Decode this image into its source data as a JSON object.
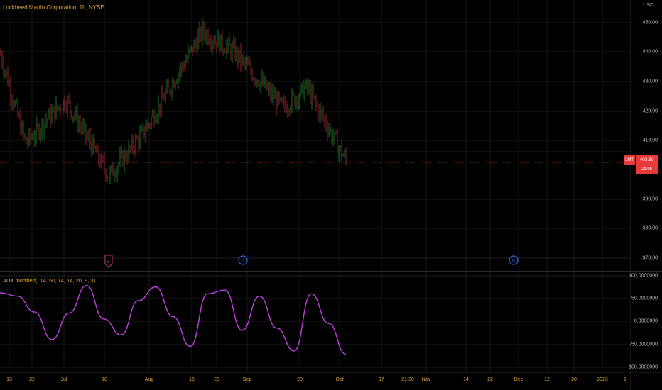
{
  "chart_title": "Lockheed Martin Corporation, 1h, NYSE",
  "currency": "USD",
  "price_axis": [
    "450.00",
    "440.00",
    "430.00",
    "420.00",
    "410.00",
    "390.00",
    "380.00",
    "370.00"
  ],
  "indicator_title": "ADX modified(, 14, 50, 14, 14, 20, 9, 3)",
  "indicator_axis": [
    "100.0000000",
    "50.0000000",
    "0.0000000",
    "-50.0000000",
    "-100.0000000"
  ],
  "time_axis": [
    "13",
    "22",
    "Jul",
    "18",
    "Aug",
    "15",
    "23",
    "Sep",
    "20",
    "Oct",
    "17",
    "21:30",
    "Nov",
    "14",
    "22",
    "Dec",
    "12",
    "20",
    "2023",
    "1"
  ],
  "last_price": {
    "symbol": "LMT",
    "price": "402.80",
    "countdown": "21:06"
  },
  "markers": [
    "E",
    "D",
    "D"
  ],
  "colors": {
    "bull": "#2e8b2e",
    "bear": "#b0303a",
    "indicator": "#c040e0",
    "price_line": "#e83a3a",
    "grid": "#1e1e1e"
  },
  "chart_data": {
    "type": "line",
    "price_series": {
      "name": "LMT",
      "x": [
        "13",
        "22",
        "Jul",
        "18",
        "Aug",
        "15",
        "23",
        "Sep",
        "20",
        "Oct"
      ],
      "values": [
        440,
        409,
        424,
        398,
        412,
        447,
        440,
        421,
        428,
        403
      ]
    },
    "adx_series": {
      "name": "ADX modified",
      "ylim": [
        -100,
        100
      ],
      "values": [
        62,
        55,
        20,
        -40,
        18,
        78,
        5,
        -30,
        45,
        75,
        10,
        -55,
        60,
        68,
        -20,
        55,
        -15,
        -65,
        60,
        -5,
        -72
      ]
    }
  }
}
